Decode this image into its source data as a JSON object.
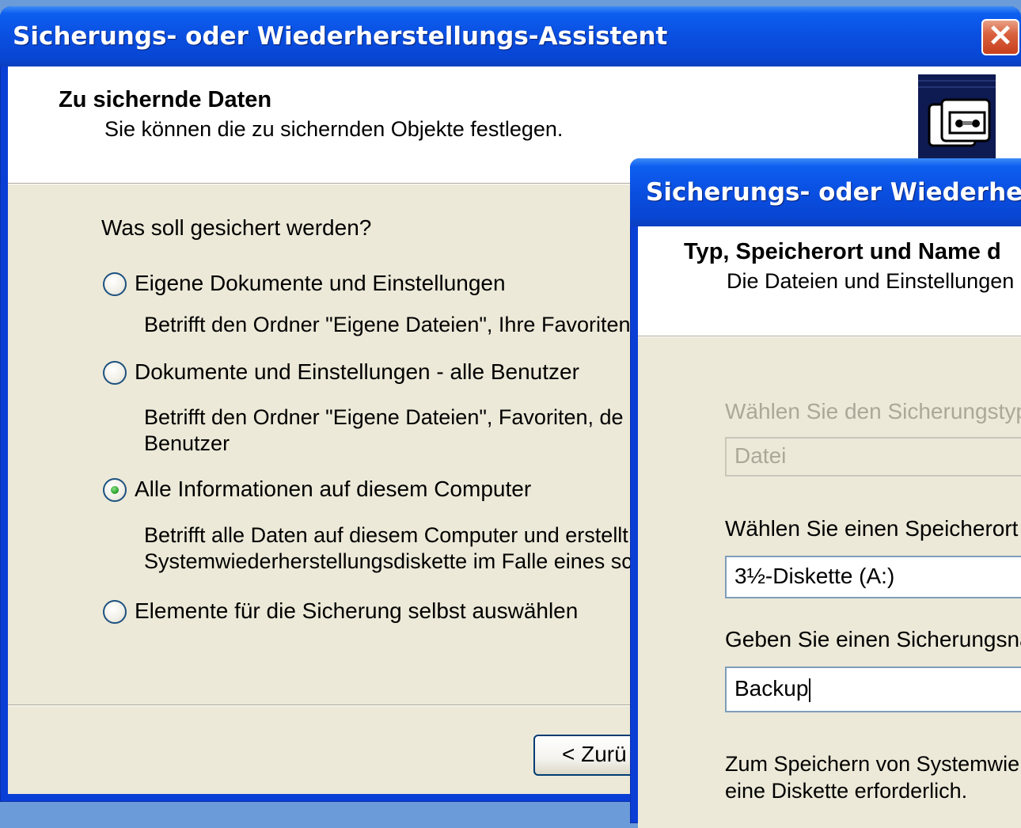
{
  "window1": {
    "title": "Sicherungs- oder Wiederherstellungs-Assistent",
    "header_title": "Zu sichernde Daten",
    "header_subtitle": "Sie können die zu sichernden Objekte festlegen.",
    "question": "Was soll gesichert werden?",
    "options": [
      {
        "label": "Eigene Dokumente und Einstellungen",
        "selected": false,
        "desc": [
          "Betrifft den Ordner \"Eigene Dateien\", Ihre Favoriten"
        ]
      },
      {
        "label": "Dokumente und Einstellungen - alle Benutzer",
        "selected": false,
        "desc": [
          "Betrifft den Ordner \"Eigene Dateien\", Favoriten, de",
          "Benutzer"
        ]
      },
      {
        "label": "Alle Informationen auf diesem Computer",
        "selected": true,
        "desc": [
          "Betrifft alle Daten auf diesem Computer und erstellt",
          "Systemwiederherstellungsdiskette im Falle eines sc"
        ]
      },
      {
        "label": "Elemente für die Sicherung selbst auswählen",
        "selected": false,
        "desc": []
      }
    ],
    "back_button": "< Zurü"
  },
  "window2": {
    "title": "Sicherungs- oder Wiederherst",
    "header_title": "Typ, Speicherort und Name d",
    "header_subtitle": "Die Dateien und Einstellungen",
    "backup_type_label": "Wählen Sie den Sicherungstyp",
    "backup_type_value": "Datei",
    "location_label": "Wählen Sie einen Speicherort f",
    "location_value": "3½-Diskette (A:)",
    "name_label": "Geben Sie einen Sicherungsna",
    "name_value": "Backup",
    "note_lines": [
      "Zum Speichern von Systemwie",
      "eine Diskette erforderlich."
    ]
  },
  "icons": {
    "close": "close-icon",
    "backup": "backup-tape-icon",
    "radio": "radio-button"
  },
  "colors": {
    "titlebar": "#0a4fe0",
    "client": "#ece9d8",
    "header": "#ffffff",
    "desktop": "#6b9bd8",
    "close": "#d9623f"
  }
}
